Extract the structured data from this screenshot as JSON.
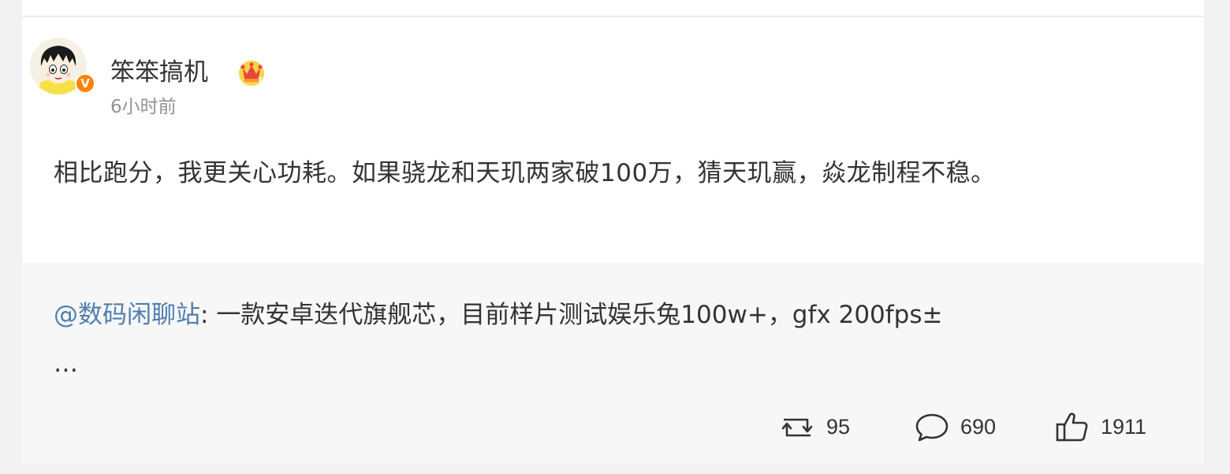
{
  "post": {
    "author": "笨笨搞机",
    "time": "6小时前",
    "verified_badge": "V",
    "text": "相比跑分，我更关心功耗。如果骁龙和天玑两家破100万，猜天玑赢，焱龙制程不稳。"
  },
  "repost": {
    "mention": "@数码闲聊站",
    "separator": ": ",
    "text": "一款安卓迭代旗舰芯，目前样片测试娱乐兔100w+，gfx 200fps±",
    "ellipsis": "…"
  },
  "actions": {
    "repost_count": "95",
    "comment_count": "690",
    "like_count": "1911"
  },
  "icons": {
    "avatar": "cartoon-avatar",
    "verified": "verified-v-icon",
    "crown": "crown-level-icon",
    "repost": "repost-icon",
    "comment": "comment-icon",
    "like": "thumbs-up-icon"
  },
  "colors": {
    "mention": "#507daf",
    "verified": "#ff8200",
    "text": "#333333",
    "muted": "#939393"
  }
}
